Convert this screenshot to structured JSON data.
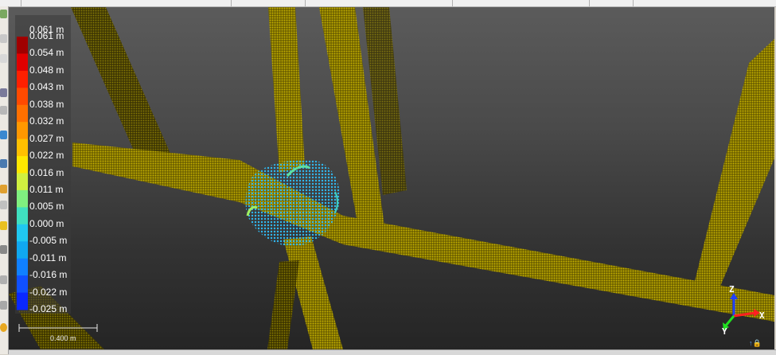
{
  "legend": {
    "max_label": "0.061 m",
    "labels": [
      "0.061 m",
      "0.054 m",
      "0.048 m",
      "0.043 m",
      "0.038 m",
      "0.032 m",
      "0.027 m",
      "0.022 m",
      "0.016 m",
      "0.011 m",
      "0.005 m",
      "0.000 m",
      "-0.005 m",
      "-0.011 m",
      "-0.016 m",
      "-0.022 m",
      "-0.025 m"
    ],
    "colors": [
      "#a00000",
      "#e00000",
      "#ff2000",
      "#ff4a00",
      "#ff7000",
      "#ff9800",
      "#ffc000",
      "#ffe800",
      "#d0f040",
      "#80f080",
      "#40e0c0",
      "#20c8f0",
      "#10a8f0",
      "#1080ff",
      "#1050ff",
      "#0a28ff",
      "#0000e0"
    ]
  },
  "scale_bar": {
    "label": "0.400 m"
  },
  "axes": {
    "z": "Z",
    "x": "X",
    "y": "Y"
  },
  "colors": {
    "pointcloud": "#b2a000",
    "background_top": "#5b5b5b",
    "background_bottom": "#252525"
  }
}
